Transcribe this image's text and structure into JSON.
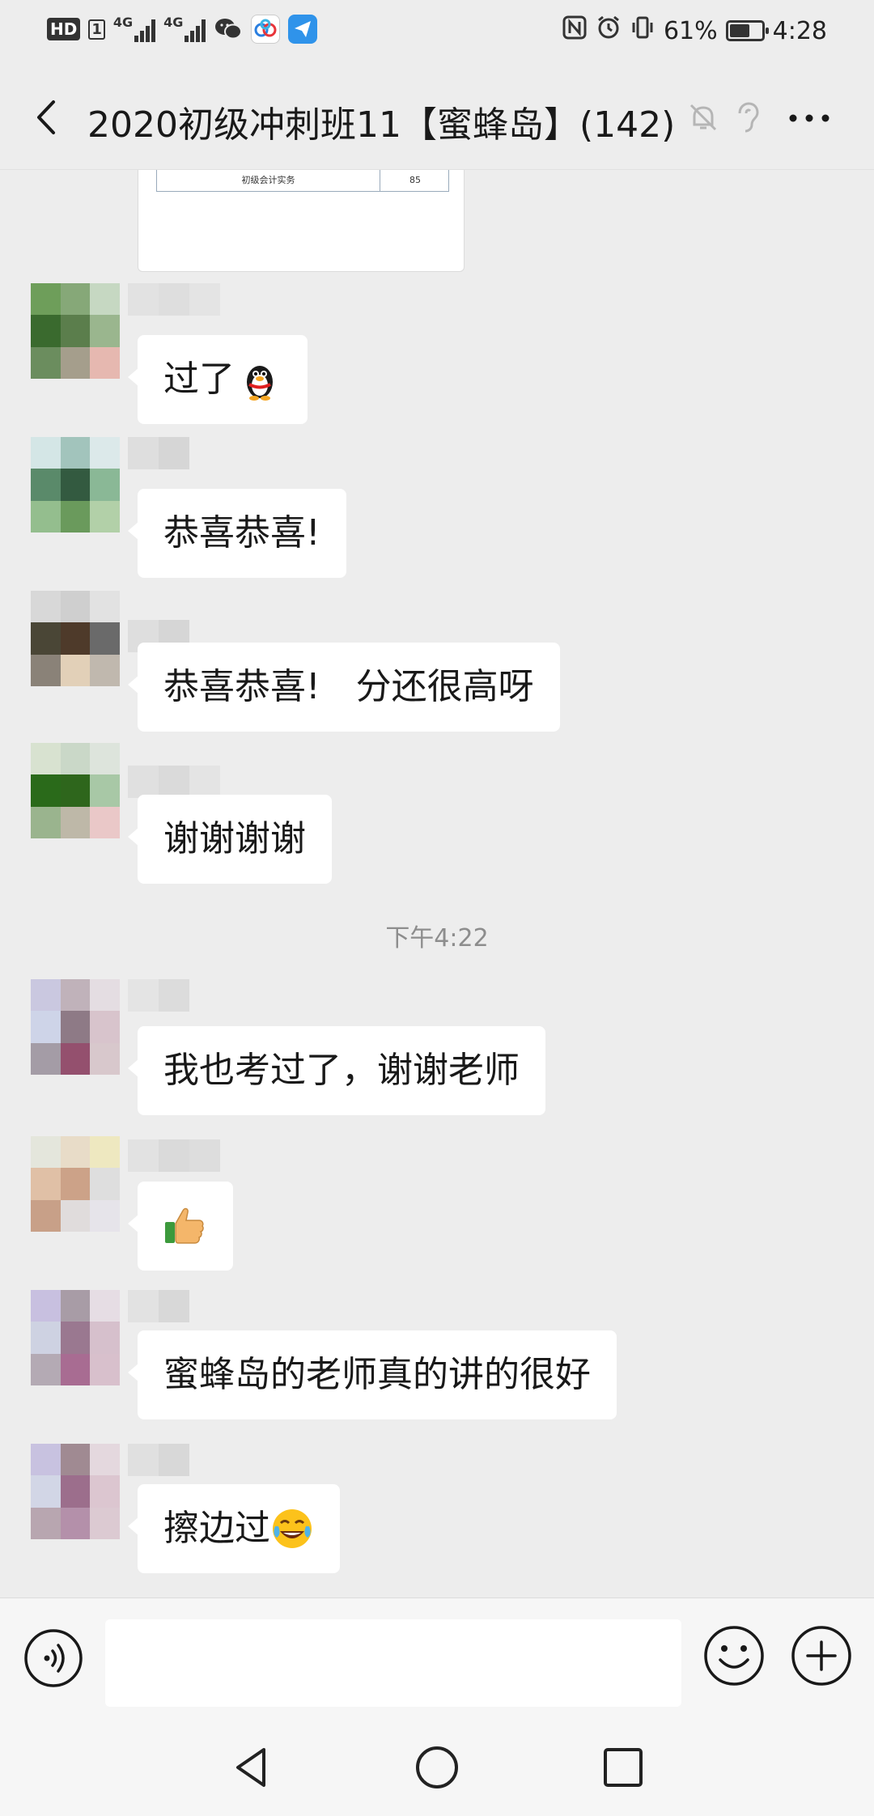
{
  "status_bar": {
    "hd": "HD",
    "hd_sub": "1",
    "net1": "4G",
    "net2": "4G",
    "battery_pct_text": "61%",
    "battery_level": 0.61,
    "time": "4:28",
    "icons": [
      "wechat-icon",
      "baidu-cloud-icon",
      "paper-plane-app-icon",
      "nfc-icon",
      "alarm-icon",
      "vibrate-icon"
    ]
  },
  "header": {
    "title": "2020初级冲刺班11【蜜蜂岛】(142)",
    "icons": [
      "back-icon",
      "mute-bell-icon",
      "earpiece-icon",
      "more-icon"
    ]
  },
  "image_preview": {
    "row_label": "初级会计实务",
    "row_value": "85"
  },
  "messages": [
    {
      "text": "过了",
      "emoji": "qq-penguin-emoji"
    },
    {
      "text": "恭喜恭喜!"
    },
    {
      "text": "恭喜恭喜!　分还很高呀"
    },
    {
      "text": "谢谢谢谢"
    },
    {
      "text": "我也考过了，谢谢老师"
    },
    {
      "text": "",
      "emoji": "thumbs-up-emoji"
    },
    {
      "text": "蜜蜂岛的老师真的讲的很好"
    },
    {
      "text": "擦边过",
      "emoji": "tears-of-joy-emoji"
    }
  ],
  "timestamp": "下午4:22",
  "input": {
    "value": "",
    "placeholder": ""
  },
  "colors": {
    "background": "#ededed",
    "bubble": "#ffffff",
    "text": "#191919",
    "timestamp": "#8d8d8d"
  }
}
